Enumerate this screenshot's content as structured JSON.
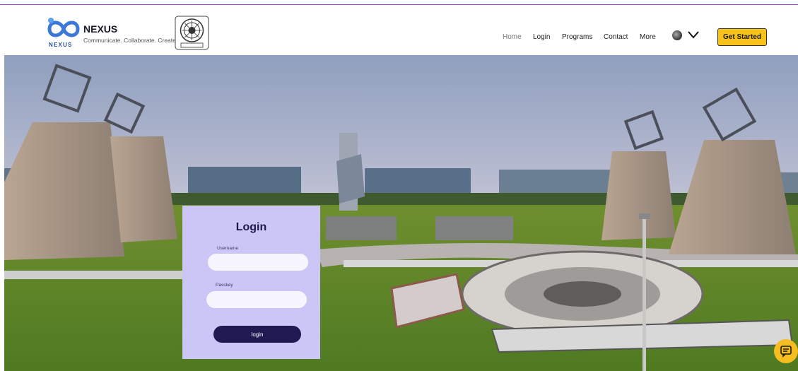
{
  "header": {
    "brand_name": "NEXUS",
    "tagline": "Communicate. Collaborate. Create.",
    "logo_caption": "NEXUS",
    "nav": [
      "Home",
      "Login",
      "Programs",
      "Contact",
      "More"
    ],
    "cta_label": "Get Started"
  },
  "login": {
    "title": "Login",
    "username_label": "Username",
    "passkey_label": "Passkey",
    "button_label": "login",
    "username_value": "",
    "passkey_value": ""
  },
  "icons": {
    "logo": "infinity-logo-icon",
    "emblem": "institute-emblem-icon",
    "avatar": "user-avatar-icon",
    "dropdown": "chevron-down-icon",
    "chat": "chat-icon"
  },
  "colors": {
    "accent_line": "#9b4dd6",
    "cta": "#f7c21a",
    "card": "#cbc6f5",
    "button": "#1f1a52",
    "chat": "#f5bd1f"
  }
}
